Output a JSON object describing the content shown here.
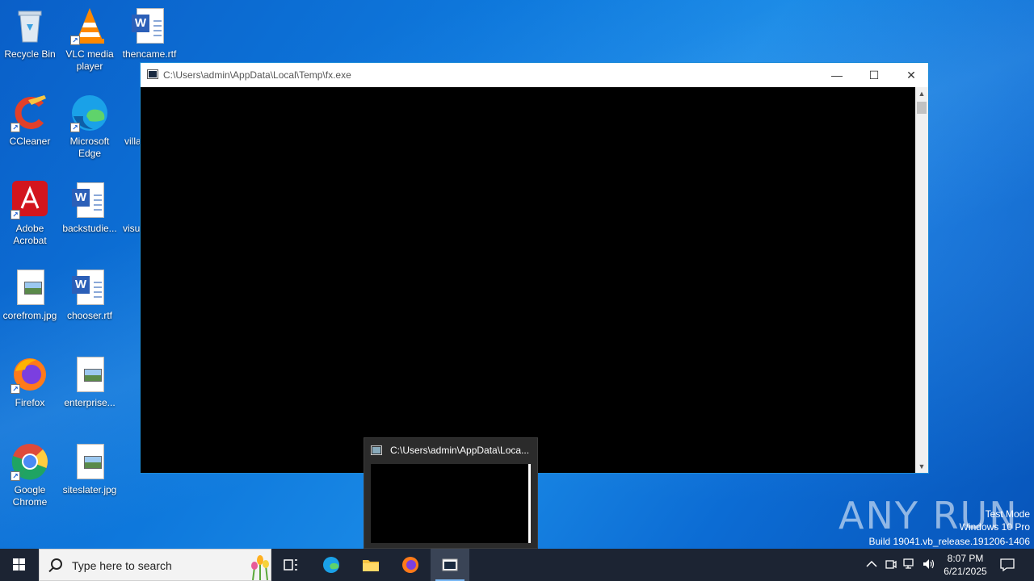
{
  "desktop": {
    "icons": [
      {
        "label": "Recycle Bin"
      },
      {
        "label": "VLC media player"
      },
      {
        "label": "thencame.rtf"
      },
      {
        "label": "CCleaner"
      },
      {
        "label": "Microsoft Edge"
      },
      {
        "label": "villa"
      },
      {
        "label": "Adobe Acrobat"
      },
      {
        "label": "backstudie..."
      },
      {
        "label": "visu"
      },
      {
        "label": "corefrom.jpg"
      },
      {
        "label": "chooser.rtf"
      },
      {
        "label": "Firefox"
      },
      {
        "label": "enterprise..."
      },
      {
        "label": "Google Chrome"
      },
      {
        "label": "siteslater.jpg"
      }
    ]
  },
  "console_window": {
    "title": "C:\\Users\\admin\\AppData\\Local\\Temp\\fx.exe",
    "minimize_glyph": "—",
    "maximize_glyph": "☐",
    "close_glyph": "✕"
  },
  "taskbar_preview": {
    "title": "C:\\Users\\admin\\AppData\\Loca..."
  },
  "watermark": {
    "brand": "ANY RUN",
    "mode": "Test Mode",
    "os": "Windows 10 Pro",
    "build": "Build 19041.vb_release.191206-1406"
  },
  "taskbar": {
    "search_placeholder": "Type here to search",
    "time": "8:07 PM",
    "date": "6/21/2025",
    "tray_icons": [
      "chevron-up-icon",
      "meet-now-icon",
      "network-icon",
      "volume-icon"
    ]
  },
  "colors": {
    "desktop_blue": "#0e78dc",
    "taskbar": "#1c2433",
    "console_bg": "#000000"
  }
}
